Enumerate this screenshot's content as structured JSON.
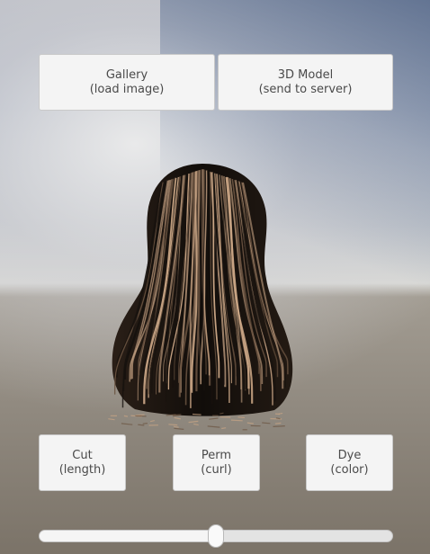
{
  "top_buttons": {
    "gallery": {
      "line1": "Gallery",
      "line2": "(load image)"
    },
    "model": {
      "line1": "3D Model",
      "line2": "(send to server)"
    }
  },
  "viewport": {
    "content": "3D hair model preview",
    "hair_colors": {
      "dark": "#17120e",
      "light": "#c9a585",
      "mid": "#6b5441"
    }
  },
  "bottom_buttons": {
    "cut": {
      "line1": "Cut",
      "line2": "(length)"
    },
    "perm": {
      "line1": "Perm",
      "line2": "(curl)"
    },
    "dye": {
      "line1": "Dye",
      "line2": "(color)"
    }
  },
  "slider": {
    "value": 0.5
  }
}
